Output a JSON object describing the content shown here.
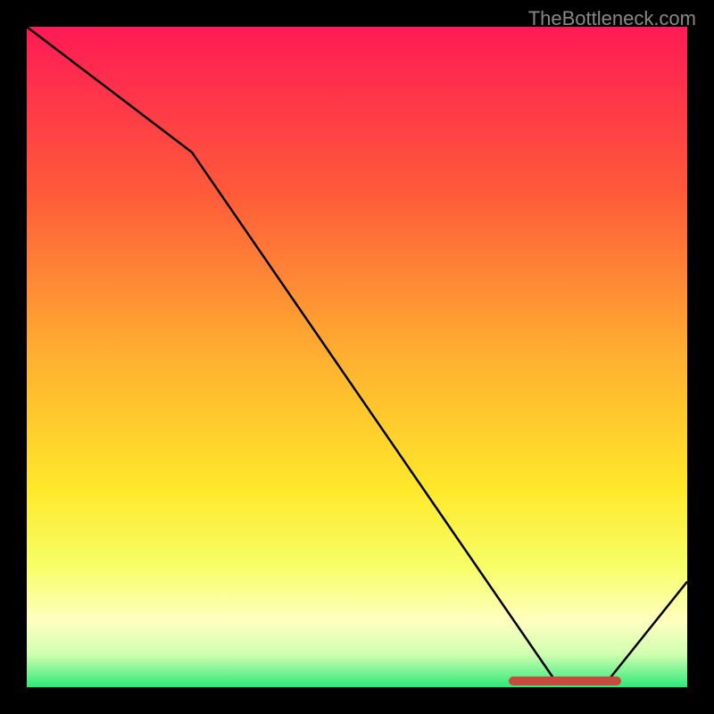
{
  "watermark": "TheBottleneck.com",
  "chart_data": {
    "type": "line",
    "title": "",
    "xlabel": "",
    "ylabel": "",
    "xlim": [
      0,
      100
    ],
    "ylim": [
      0,
      100
    ],
    "x": [
      0,
      25,
      80,
      88,
      100
    ],
    "values": [
      100,
      81,
      1,
      1,
      16
    ],
    "optimal_range": {
      "start": 73,
      "end": 90
    },
    "gradient_stops": [
      {
        "pos": 0,
        "color": "#ff1a55"
      },
      {
        "pos": 0.25,
        "color": "#ff5a3a"
      },
      {
        "pos": 0.5,
        "color": "#ffb030"
      },
      {
        "pos": 0.7,
        "color": "#ffe82a"
      },
      {
        "pos": 0.82,
        "color": "#f7ff6a"
      },
      {
        "pos": 0.9,
        "color": "#ffffc0"
      },
      {
        "pos": 0.95,
        "color": "#d0ffb0"
      },
      {
        "pos": 1.0,
        "color": "#2fe87a"
      }
    ]
  }
}
